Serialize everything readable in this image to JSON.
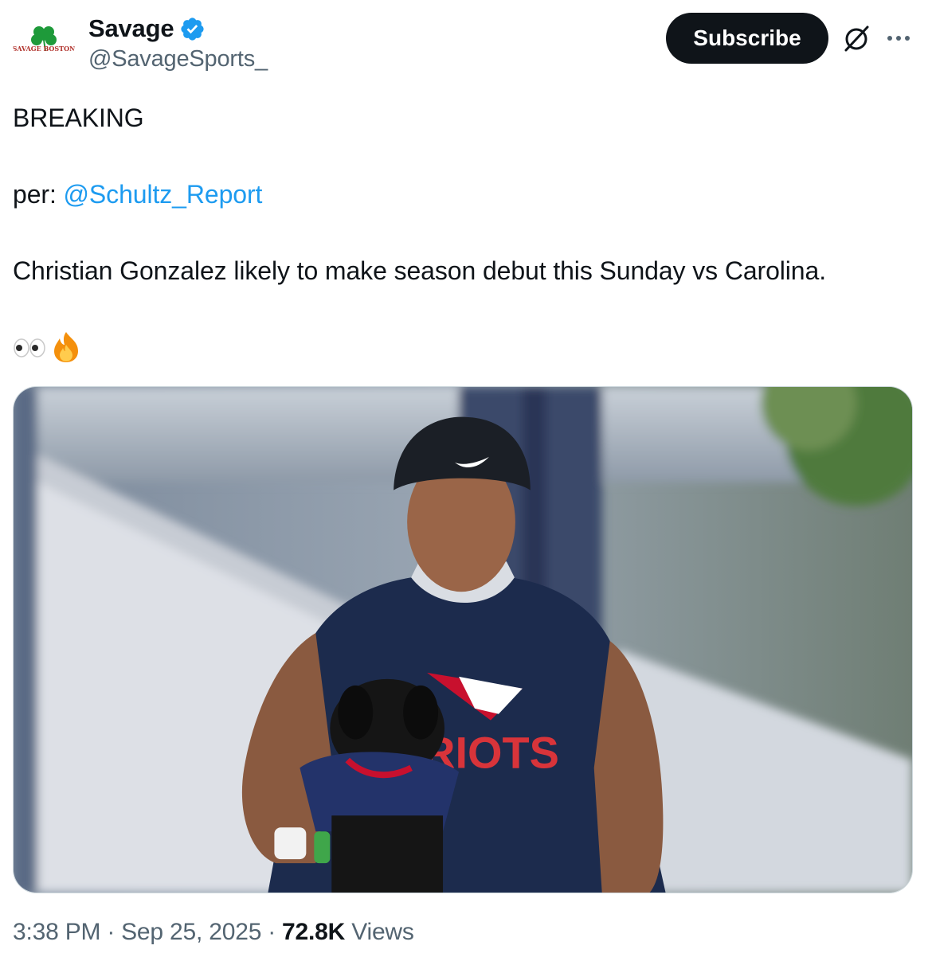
{
  "author": {
    "avatar_label": "SAVAGE BOSTON",
    "display_name": "Savage",
    "handle": "@SavageSports_",
    "verified": true
  },
  "header": {
    "subscribe_label": "Subscribe",
    "grok_icon": "grok-icon",
    "more_icon": "more-icon"
  },
  "tweet": {
    "line1": "BREAKING",
    "per_prefix": "per: ",
    "mention": "@Schultz_Report",
    "line3": "Christian Gonzalez likely to make season debut this Sunday vs Carolina.",
    "emojis": [
      "eyes",
      "fire"
    ]
  },
  "media": {
    "jersey_text": "RIOTS"
  },
  "meta": {
    "time": "3:38 PM",
    "date": "Sep 25, 2025",
    "views_count": "72.8K",
    "views_label": "Views"
  },
  "colors": {
    "text": "#0f1419",
    "secondary": "#536471",
    "link": "#1d9bf0",
    "verified": "#1d9bf0"
  }
}
